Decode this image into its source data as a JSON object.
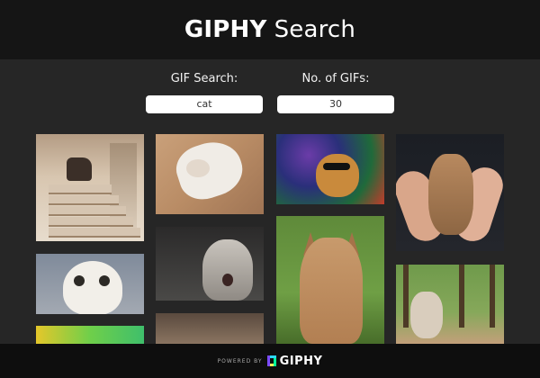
{
  "header": {
    "brand": "GIPHY",
    "rest": "Search"
  },
  "controls": {
    "search_label": "GIF Search:",
    "search_value": "cat",
    "count_label": "No. of GIFs:",
    "count_value": "30"
  },
  "results": {
    "tiles": [
      {
        "id": 1,
        "subject": "cat at top of stairs"
      },
      {
        "id": 2,
        "subject": "white cat rolling on floor"
      },
      {
        "id": 3,
        "subject": "cat with sunglasses and space background"
      },
      {
        "id": 4,
        "subject": "cat held in hands"
      },
      {
        "id": 5,
        "subject": "white cat face close-up"
      },
      {
        "id": 6,
        "subject": "surprised cat"
      },
      {
        "id": 7,
        "subject": "caracal in grass"
      },
      {
        "id": 8,
        "subject": "cat in park"
      },
      {
        "id": 9,
        "subject": "colorful partial tile"
      },
      {
        "id": 10,
        "subject": "room scene partial tile"
      }
    ]
  },
  "footer": {
    "powered_by": "POWERED BY",
    "brand": "GIPHY"
  },
  "colors": {
    "page_bg": "#262626",
    "header_bg": "#151515",
    "footer_bg": "#0e0e0e"
  }
}
